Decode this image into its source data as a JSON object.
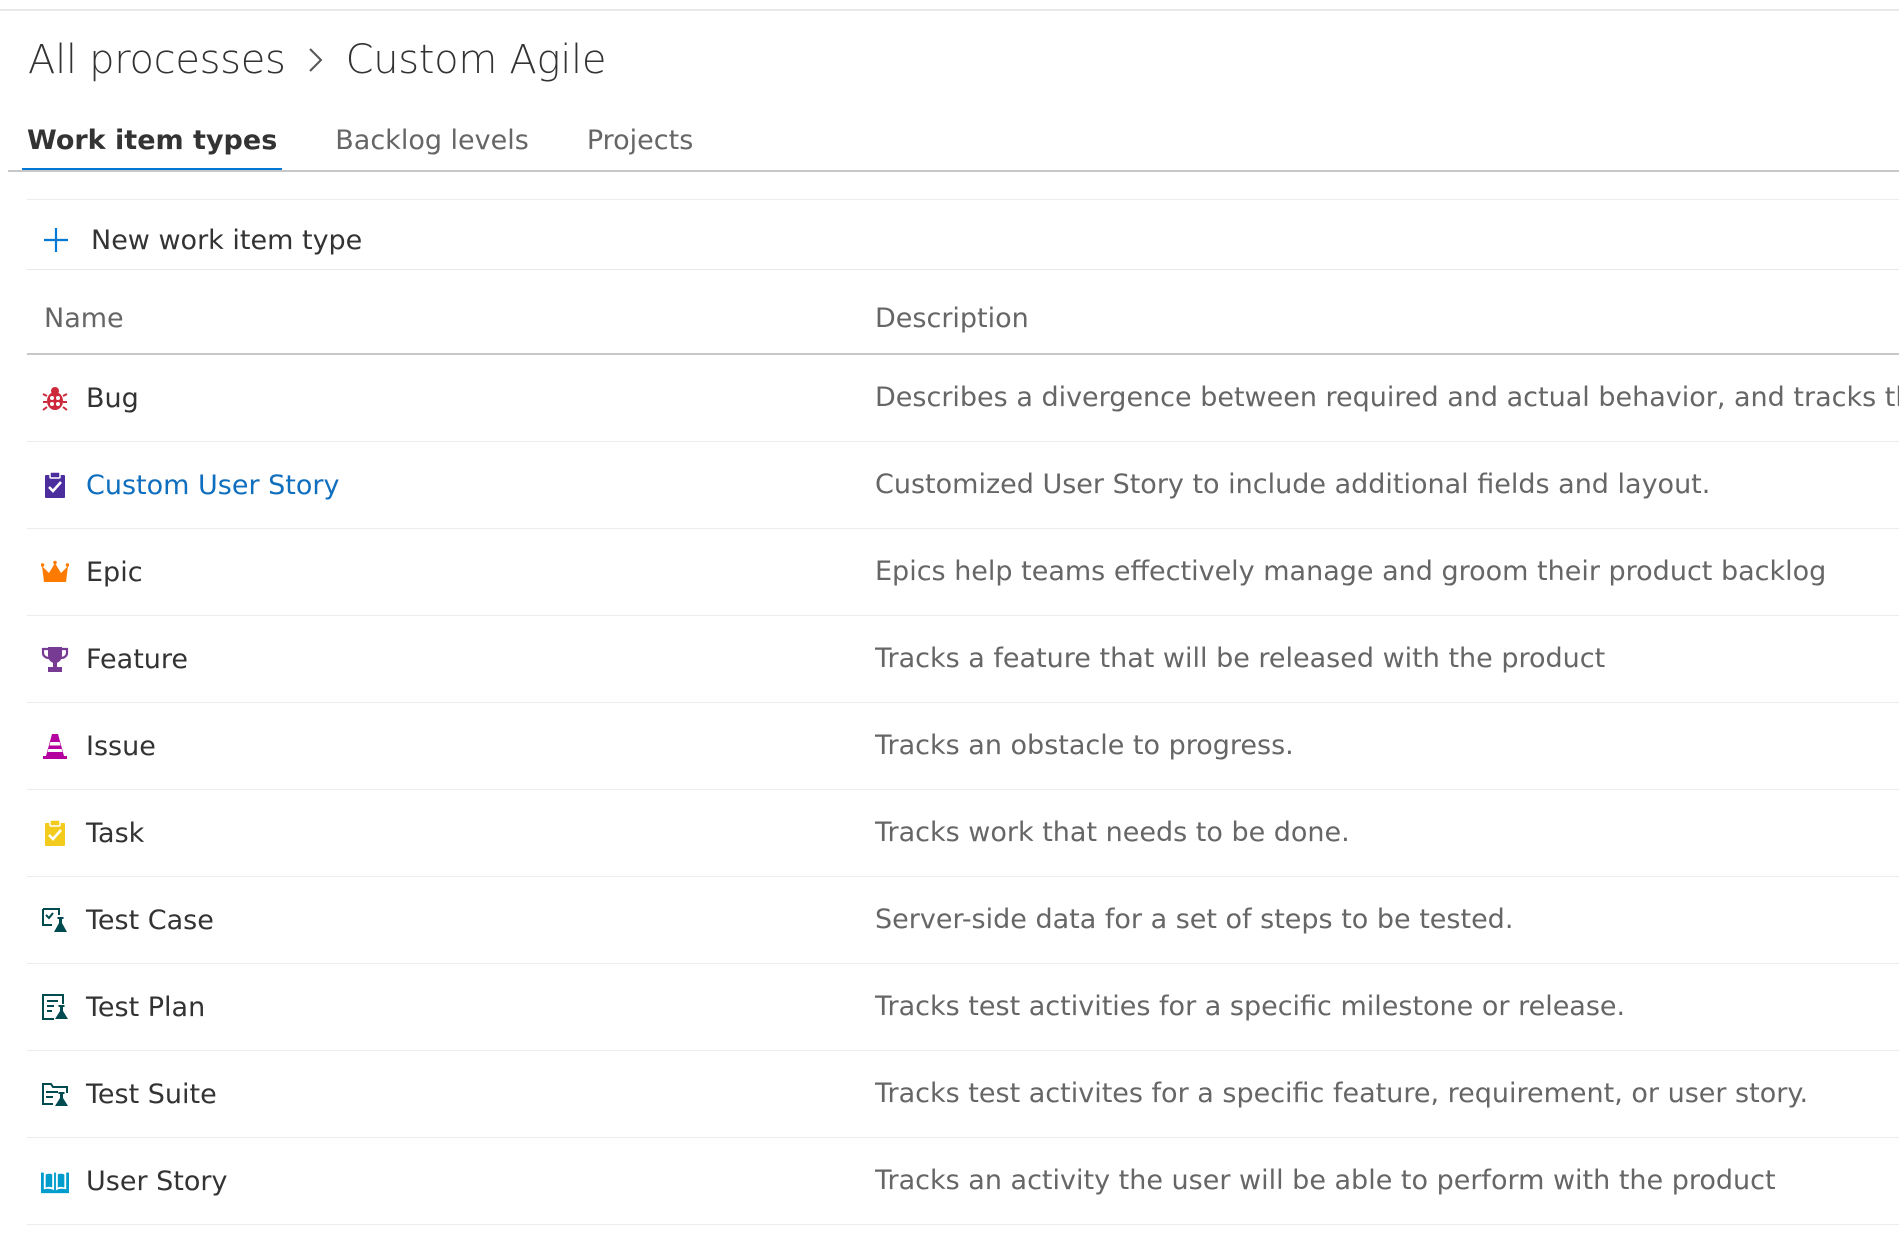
{
  "breadcrumb": {
    "root": "All processes",
    "current": "Custom Agile"
  },
  "tabs": [
    {
      "label": "Work item types",
      "selected": true
    },
    {
      "label": "Backlog levels",
      "selected": false
    },
    {
      "label": "Projects",
      "selected": false
    }
  ],
  "toolbar": {
    "new_label": "New work item type",
    "new_icon": "plus-icon"
  },
  "table": {
    "columns": [
      "Name",
      "Description"
    ],
    "rows": [
      {
        "name": "Bug",
        "description": "Describes a divergence between required and actual behavior, and tracks the work",
        "icon": "bug-icon",
        "color": "#cc293d",
        "link": false
      },
      {
        "name": "Custom User Story",
        "description": "Customized User Story to include additional fields and layout.",
        "icon": "clipboard-check-icon",
        "color": "#4c2d9e",
        "link": true
      },
      {
        "name": "Epic",
        "description": "Epics help teams effectively manage and groom their product backlog",
        "icon": "crown-icon",
        "color": "#ff7b00",
        "link": false
      },
      {
        "name": "Feature",
        "description": "Tracks a feature that will be released with the product",
        "icon": "trophy-icon",
        "color": "#773b93",
        "link": false
      },
      {
        "name": "Issue",
        "description": "Tracks an obstacle to progress.",
        "icon": "traffic-cone-icon",
        "color": "#b4009e",
        "link": false
      },
      {
        "name": "Task",
        "description": "Tracks work that needs to be done.",
        "icon": "clipboard-check-icon",
        "color": "#f2cb1d",
        "link": false
      },
      {
        "name": "Test Case",
        "description": "Server-side data for a set of steps to be tested.",
        "icon": "test-case-icon",
        "color": "#004b50",
        "link": false
      },
      {
        "name": "Test Plan",
        "description": "Tracks test activities for a specific milestone or release.",
        "icon": "test-plan-icon",
        "color": "#004b50",
        "link": false
      },
      {
        "name": "Test Suite",
        "description": "Tracks test activites for a specific feature, requirement, or user story.",
        "icon": "test-suite-icon",
        "color": "#004b50",
        "link": false
      },
      {
        "name": "User Story",
        "description": "Tracks an activity the user will be able to perform with the product",
        "icon": "book-icon",
        "color": "#009ccc",
        "link": false
      }
    ]
  }
}
